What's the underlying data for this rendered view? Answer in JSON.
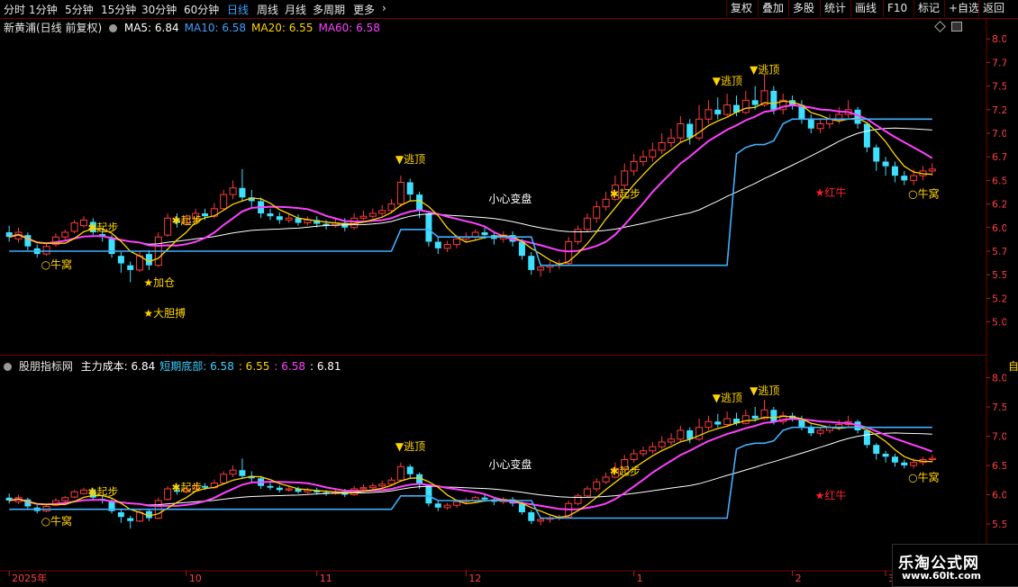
{
  "toolbar": {
    "left_items": [
      {
        "label": "分时"
      },
      {
        "label": "1分钟"
      },
      {
        "label": "5分钟"
      },
      {
        "label": "15分钟"
      },
      {
        "label": "30分钟"
      },
      {
        "label": "60分钟"
      },
      {
        "label": "日线",
        "active": true
      },
      {
        "label": "周线"
      },
      {
        "label": "月线"
      },
      {
        "label": "多周期"
      },
      {
        "label": "更多"
      }
    ],
    "right_items": [
      {
        "label": "复权"
      },
      {
        "label": "叠加"
      },
      {
        "label": "多股"
      },
      {
        "label": "统计"
      },
      {
        "label": "画线"
      },
      {
        "label": "F10"
      },
      {
        "label": "标记"
      },
      {
        "label": "+自选"
      },
      {
        "label": "返回"
      }
    ]
  },
  "main_panel": {
    "stock_title": "新黄浦(日线 前复权)",
    "ma": [
      {
        "label": "MA5: 6.84",
        "color": "#ffffff"
      },
      {
        "label": "MA10: 6.58",
        "color": "#3fa0ff"
      },
      {
        "label": "MA20: 6.55",
        "color": "#ffd400"
      },
      {
        "label": "MA60: 6.58",
        "color": "#ff40ff"
      }
    ]
  },
  "indicator_panel": {
    "name": "股朋指标网",
    "values": [
      {
        "label": "主力成本: 6.84",
        "color": "#ffffff"
      },
      {
        "label": "短期底部: 6.58",
        "color": "#3fd0ff"
      },
      {
        "label": ": 6.55",
        "color": "#ffd400"
      },
      {
        "label": ": 6.58",
        "color": "#ff40ff"
      },
      {
        "label": ": 6.81",
        "color": "#ffffff"
      }
    ],
    "right_edge_char": "自"
  },
  "watermark": {
    "line1": "乐淘公式网",
    "line2": "www.60lt.com"
  },
  "chart_data": [
    {
      "type": "candlestick",
      "panel": "main",
      "y_ticks": [
        "8.00",
        "7.75",
        "7.50",
        "7.25",
        "7.00",
        "6.75",
        "6.50",
        "6.25",
        "6.00",
        "5.75",
        "5.50",
        "5.25",
        "5.00"
      ],
      "ylim": [
        4.9,
        8.05
      ],
      "candles": [
        [
          5.95,
          5.9,
          6.02,
          5.85
        ],
        [
          5.88,
          5.95,
          6.0,
          5.84
        ],
        [
          5.92,
          5.8,
          5.95,
          5.76
        ],
        [
          5.78,
          5.72,
          5.82,
          5.68
        ],
        [
          5.72,
          5.8,
          5.84,
          5.7
        ],
        [
          5.82,
          5.9,
          5.94,
          5.8
        ],
        [
          5.9,
          5.95,
          5.98,
          5.86
        ],
        [
          5.96,
          6.05,
          6.08,
          5.94
        ],
        [
          6.02,
          6.08,
          6.12,
          6.0
        ],
        [
          6.06,
          5.95,
          6.1,
          5.92
        ],
        [
          5.93,
          5.9,
          5.98,
          5.85
        ],
        [
          5.88,
          5.72,
          5.92,
          5.68
        ],
        [
          5.7,
          5.62,
          5.74,
          5.52
        ],
        [
          5.6,
          5.55,
          5.64,
          5.42
        ],
        [
          5.55,
          5.7,
          5.75,
          5.53
        ],
        [
          5.72,
          5.6,
          5.76,
          5.55
        ],
        [
          5.6,
          5.9,
          5.95,
          5.58
        ],
        [
          5.92,
          6.1,
          6.15,
          5.9
        ],
        [
          6.08,
          6.05,
          6.15,
          6.0
        ],
        [
          6.05,
          6.1,
          6.14,
          6.02
        ],
        [
          6.1,
          6.15,
          6.2,
          6.06
        ],
        [
          6.15,
          6.12,
          6.2,
          6.08
        ],
        [
          6.12,
          6.2,
          6.26,
          6.1
        ],
        [
          6.2,
          6.35,
          6.4,
          6.18
        ],
        [
          6.35,
          6.42,
          6.5,
          6.3
        ],
        [
          6.42,
          6.32,
          6.62,
          6.28
        ],
        [
          6.32,
          6.28,
          6.4,
          6.22
        ],
        [
          6.28,
          6.15,
          6.32,
          6.1
        ],
        [
          6.15,
          6.12,
          6.2,
          6.08
        ],
        [
          6.12,
          6.08,
          6.16,
          6.04
        ],
        [
          6.08,
          6.1,
          6.15,
          6.05
        ],
        [
          6.1,
          6.05,
          6.14,
          6.02
        ],
        [
          6.05,
          6.08,
          6.12,
          6.02
        ],
        [
          6.08,
          6.04,
          6.12,
          6.0
        ],
        [
          6.04,
          6.02,
          6.08,
          5.98
        ],
        [
          6.02,
          6.05,
          6.1,
          6.0
        ],
        [
          6.05,
          6.0,
          6.1,
          5.96
        ],
        [
          6.0,
          6.1,
          6.15,
          5.98
        ],
        [
          6.1,
          6.12,
          6.18,
          6.08
        ],
        [
          6.12,
          6.15,
          6.2,
          6.1
        ],
        [
          6.15,
          6.18,
          6.24,
          6.12
        ],
        [
          6.18,
          6.25,
          6.3,
          6.15
        ],
        [
          6.25,
          6.48,
          6.55,
          6.22
        ],
        [
          6.48,
          6.35,
          6.52,
          6.28
        ],
        [
          6.35,
          6.18,
          6.38,
          6.1
        ],
        [
          6.15,
          5.85,
          6.18,
          5.8
        ],
        [
          5.85,
          5.78,
          5.9,
          5.72
        ],
        [
          5.78,
          5.82,
          5.86,
          5.74
        ],
        [
          5.82,
          5.88,
          5.92,
          5.78
        ],
        [
          5.88,
          5.9,
          5.95,
          5.84
        ],
        [
          5.9,
          5.95,
          5.98,
          5.86
        ],
        [
          5.95,
          5.92,
          6.0,
          5.88
        ],
        [
          5.92,
          5.88,
          5.96,
          5.82
        ],
        [
          5.88,
          5.92,
          5.96,
          5.84
        ],
        [
          5.92,
          5.85,
          5.96,
          5.8
        ],
        [
          5.85,
          5.7,
          5.88,
          5.66
        ],
        [
          5.7,
          5.55,
          5.74,
          5.5
        ],
        [
          5.55,
          5.58,
          5.62,
          5.48
        ],
        [
          5.58,
          5.6,
          5.64,
          5.52
        ],
        [
          5.6,
          5.62,
          5.66,
          5.56
        ],
        [
          5.62,
          5.85,
          5.9,
          5.6
        ],
        [
          5.85,
          5.98,
          6.02,
          5.82
        ],
        [
          5.98,
          6.1,
          6.15,
          5.95
        ],
        [
          6.1,
          6.22,
          6.28,
          6.05
        ],
        [
          6.22,
          6.3,
          6.38,
          6.18
        ],
        [
          6.3,
          6.45,
          6.55,
          6.28
        ],
        [
          6.45,
          6.6,
          6.68,
          6.4
        ],
        [
          6.6,
          6.7,
          6.78,
          6.55
        ],
        [
          6.7,
          6.75,
          6.82,
          6.65
        ],
        [
          6.75,
          6.82,
          6.9,
          6.7
        ],
        [
          6.82,
          6.9,
          7.0,
          6.78
        ],
        [
          6.9,
          6.95,
          7.05,
          6.85
        ],
        [
          6.95,
          7.1,
          7.18,
          6.9
        ],
        [
          7.1,
          6.95,
          7.15,
          6.88
        ],
        [
          6.95,
          7.15,
          7.3,
          6.92
        ],
        [
          7.15,
          7.25,
          7.35,
          7.1
        ],
        [
          7.25,
          7.2,
          7.38,
          7.15
        ],
        [
          7.2,
          7.3,
          7.42,
          7.18
        ],
        [
          7.3,
          7.22,
          7.4,
          7.18
        ],
        [
          7.22,
          7.35,
          7.45,
          7.2
        ],
        [
          7.35,
          7.3,
          7.5,
          7.25
        ],
        [
          7.3,
          7.45,
          7.62,
          7.28
        ],
        [
          7.45,
          7.25,
          7.5,
          7.2
        ],
        [
          7.25,
          7.35,
          7.42,
          7.2
        ],
        [
          7.35,
          7.3,
          7.4,
          7.25
        ],
        [
          7.3,
          7.15,
          7.35,
          7.1
        ],
        [
          7.15,
          7.05,
          7.2,
          7.0
        ],
        [
          7.05,
          7.1,
          7.15,
          7.0
        ],
        [
          7.1,
          7.15,
          7.2,
          7.05
        ],
        [
          7.15,
          7.2,
          7.28,
          7.1
        ],
        [
          7.2,
          7.25,
          7.35,
          7.15
        ],
        [
          7.25,
          7.1,
          7.28,
          7.05
        ],
        [
          7.1,
          6.85,
          7.12,
          6.8
        ],
        [
          6.85,
          6.7,
          6.88,
          6.6
        ],
        [
          6.7,
          6.65,
          6.75,
          6.55
        ],
        [
          6.65,
          6.55,
          6.7,
          6.48
        ],
        [
          6.55,
          6.5,
          6.6,
          6.45
        ],
        [
          6.5,
          6.55,
          6.62,
          6.45
        ],
        [
          6.55,
          6.6,
          6.65,
          6.5
        ],
        [
          6.6,
          6.62,
          6.68,
          6.55
        ]
      ],
      "series": [
        {
          "name": "MA5",
          "color": "#ffd400"
        },
        {
          "name": "MA10",
          "color": "#ff40ff"
        },
        {
          "name": "MA60",
          "color": "#ffffff"
        },
        {
          "name": "短期底部",
          "color": "#3fa0ff"
        }
      ],
      "signals": [
        {
          "index": 4,
          "label": "○牛窝",
          "color": "#ffd400"
        },
        {
          "index": 9,
          "label": "✱起步",
          "color": "#ffd400"
        },
        {
          "index": 15,
          "label": "★加仓",
          "color": "#ffd400"
        },
        {
          "index": 15,
          "label": "★大胆搏",
          "color": "#ffd400"
        },
        {
          "index": 18,
          "label": "✱起步",
          "color": "#ffd400"
        },
        {
          "index": 42,
          "label": "▼逃顶",
          "color": "#ffd400"
        },
        {
          "index": 52,
          "label": "小心变盘",
          "color": "#ffffff"
        },
        {
          "index": 65,
          "label": "✱起步",
          "color": "#ffd400"
        },
        {
          "index": 76,
          "label": "▼逃顶",
          "color": "#ffd400"
        },
        {
          "index": 80,
          "label": "▼逃顶",
          "color": "#ffd400"
        },
        {
          "index": 87,
          "label": "★红牛",
          "color": "#ff2020"
        },
        {
          "index": 97,
          "label": "○牛窝",
          "color": "#ffd400"
        }
      ]
    },
    {
      "type": "candlestick",
      "panel": "indicator",
      "y_ticks": [
        "8.00",
        "7.50",
        "7.00",
        "6.50",
        "6.00",
        "5.50"
      ],
      "ylim": [
        5.3,
        8.1
      ],
      "x_ticks": [
        "2025年",
        "10",
        "11",
        "12",
        "1",
        "2",
        "3"
      ],
      "x_tick_index": [
        0,
        19,
        33,
        49,
        67,
        84,
        94
      ]
    }
  ]
}
